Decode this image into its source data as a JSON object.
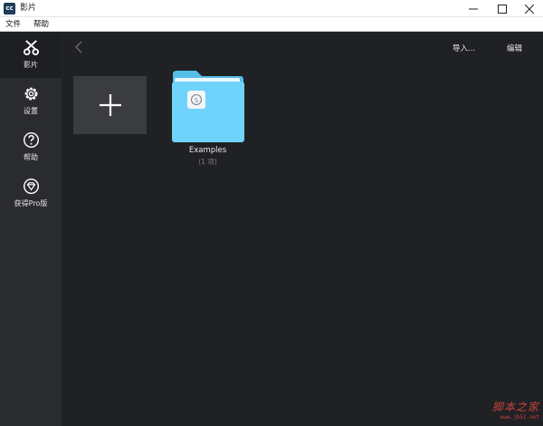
{
  "window": {
    "title": "影片",
    "app_icon_text": "cc"
  },
  "menubar": {
    "items": [
      "文件",
      "帮助"
    ]
  },
  "sidebar": {
    "items": [
      {
        "label": "影片",
        "icon": "scissors-icon",
        "active": true
      },
      {
        "label": "设置",
        "icon": "gear-icon",
        "active": false
      },
      {
        "label": "帮助",
        "icon": "help-circle-icon",
        "active": false
      },
      {
        "label": "获得Pro版",
        "icon": "diamond-icon",
        "active": false
      }
    ]
  },
  "toolbar": {
    "import_label": "导入...",
    "edit_label": "编辑"
  },
  "folder": {
    "name": "Examples",
    "count": "(1 项)"
  },
  "watermark": {
    "main": "脚本之家",
    "sub": "www.jb51.net"
  },
  "colors": {
    "background": "#202124",
    "sidebar": "#2a2b2e",
    "tile": "#3b3c40",
    "folder": "#6fd3fb",
    "watermark": "#c7413a"
  }
}
